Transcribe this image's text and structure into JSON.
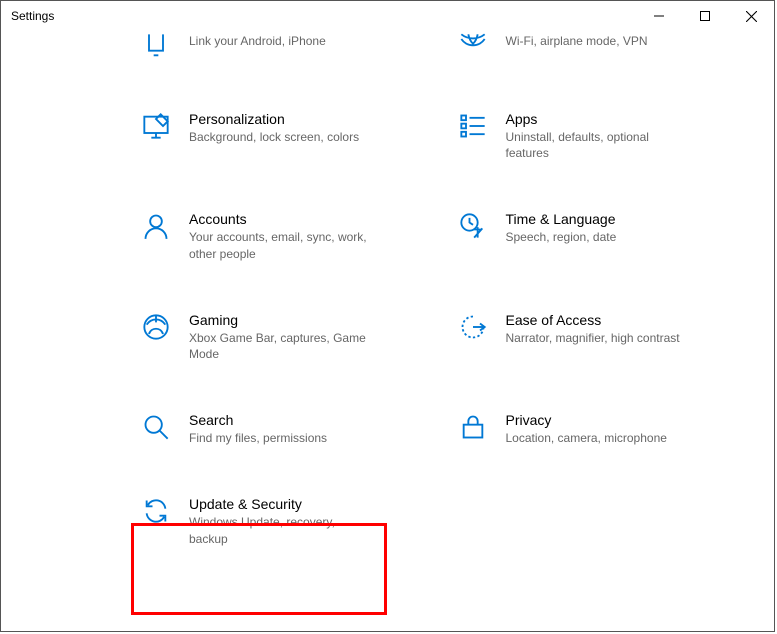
{
  "window": {
    "title": "Settings"
  },
  "tiles": {
    "phone": {
      "label": "",
      "desc": "Link your Android, iPhone"
    },
    "network": {
      "label": "",
      "desc": "Wi-Fi, airplane mode, VPN"
    },
    "personalization": {
      "label": "Personalization",
      "desc": "Background, lock screen, colors"
    },
    "apps": {
      "label": "Apps",
      "desc": "Uninstall, defaults, optional features"
    },
    "accounts": {
      "label": "Accounts",
      "desc": "Your accounts, email, sync, work, other people"
    },
    "time": {
      "label": "Time & Language",
      "desc": "Speech, region, date"
    },
    "gaming": {
      "label": "Gaming",
      "desc": "Xbox Game Bar, captures, Game Mode"
    },
    "ease": {
      "label": "Ease of Access",
      "desc": "Narrator, magnifier, high contrast"
    },
    "search": {
      "label": "Search",
      "desc": "Find my files, permissions"
    },
    "privacy": {
      "label": "Privacy",
      "desc": "Location, camera, microphone"
    },
    "update": {
      "label": "Update & Security",
      "desc": "Windows Update, recovery, backup"
    }
  }
}
